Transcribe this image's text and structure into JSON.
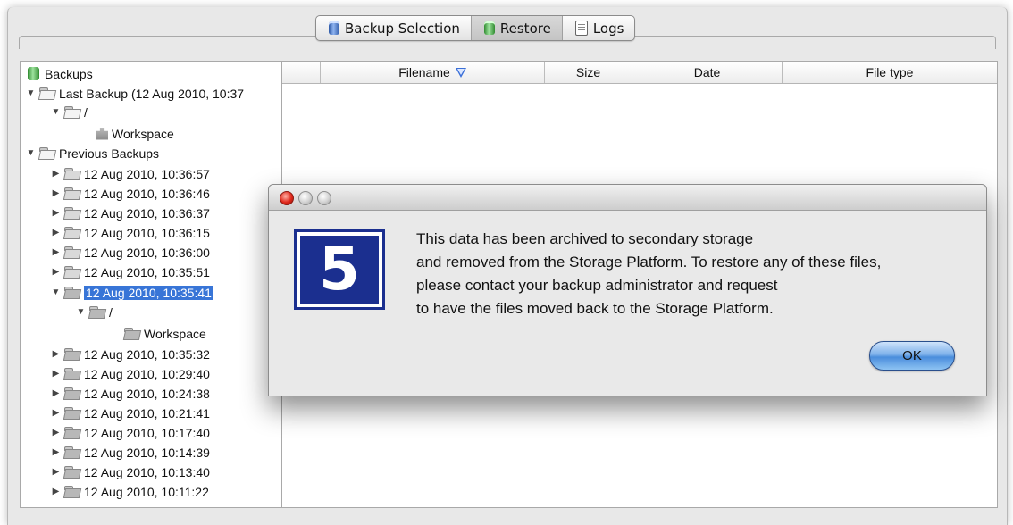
{
  "tabs": [
    {
      "label": "Backup Selection",
      "icon": "database-blue-icon",
      "selected": false
    },
    {
      "label": "Restore",
      "icon": "database-green-icon",
      "selected": true
    },
    {
      "label": "Logs",
      "icon": "log-document-icon",
      "selected": false
    }
  ],
  "tree": {
    "root_label": "Backups",
    "last_backup_label": "Last Backup (12 Aug 2010, 10:37",
    "slash": "/",
    "workspace": "Workspace",
    "previous_label": "Previous Backups",
    "backups_before": [
      "12 Aug 2010, 10:36:57",
      "12 Aug 2010, 10:36:46",
      "12 Aug 2010, 10:36:37",
      "12 Aug 2010, 10:36:15",
      "12 Aug 2010, 10:36:00",
      "12 Aug 2010, 10:35:51"
    ],
    "selected_backup": "12 Aug 2010, 10:35:41",
    "backups_after": [
      "12 Aug 2010, 10:35:32",
      "12 Aug 2010, 10:29:40",
      "12 Aug 2010, 10:24:38",
      "12 Aug 2010, 10:21:41",
      "12 Aug 2010, 10:17:40",
      "12 Aug 2010, 10:14:39",
      "12 Aug 2010, 10:13:40",
      "12 Aug 2010, 10:11:22"
    ]
  },
  "table": {
    "columns": [
      "",
      "Filename",
      "Size",
      "Date",
      "File type"
    ],
    "sorted_column": "Filename"
  },
  "dialog": {
    "logo_text": "5",
    "message_lines": [
      "This data has been archived to secondary storage",
      "and removed from the Storage Platform. To restore any of these files,",
      "please contact your backup administrator and request",
      "to have the files moved back to the Storage Platform."
    ],
    "ok_label": "OK"
  },
  "colors": {
    "selection": "#3875d7",
    "logo_blue": "#1b2f8f",
    "sort_arrow": "#3a6fd8"
  }
}
